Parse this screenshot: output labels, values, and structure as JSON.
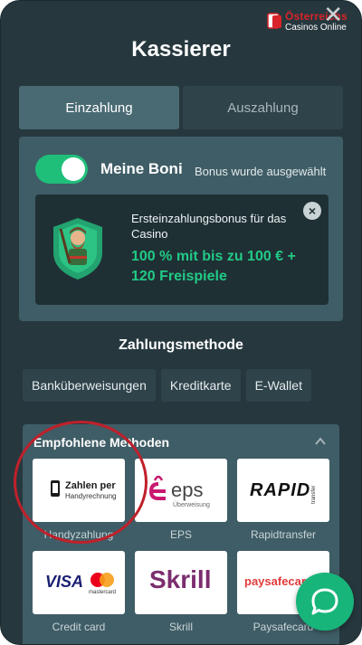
{
  "site": {
    "logo_line1": "Österreichs",
    "logo_line2": "Casinos Online"
  },
  "header": {
    "title": "Kassierer",
    "close_glyph": "✕"
  },
  "tabs": [
    {
      "label": "Einzahlung",
      "active": true
    },
    {
      "label": "Auszahlung",
      "active": false
    }
  ],
  "bonus": {
    "toggle_on": true,
    "label": "Meine Boni",
    "status": "Bonus wurde ausgewählt",
    "card": {
      "title": "Ersteinzahlungsbonus für das Casino",
      "offer": "100 % mit bis zu 100 € + 120 Freispiele"
    }
  },
  "payment": {
    "title": "Zahlungsmethode",
    "categories": [
      "Banküberweisungen",
      "Kreditkarte",
      "E-Wallet"
    ],
    "recommended_title": "Empfohlene Methoden",
    "methods": [
      {
        "label": "Handyzahlung",
        "logo": "Zahlen per",
        "logo_sub": "Handyrechnung"
      },
      {
        "label": "EPS",
        "logo": "eps",
        "logo_sub": "Überweisung"
      },
      {
        "label": "Rapidtransfer",
        "logo": "RAPID",
        "logo_sub": "transfer"
      },
      {
        "label": "Credit card",
        "logo": "VISA",
        "logo_sub": "mastercard"
      },
      {
        "label": "Skrill",
        "logo": "Skrill",
        "logo_sub": ""
      },
      {
        "label": "Paysafecard",
        "logo": "paysafecard",
        "logo_sub": ""
      }
    ]
  },
  "colors": {
    "accent_green": "#1fbf7a",
    "highlight_ring": "#c0202a",
    "panel": "#3f5d66"
  }
}
